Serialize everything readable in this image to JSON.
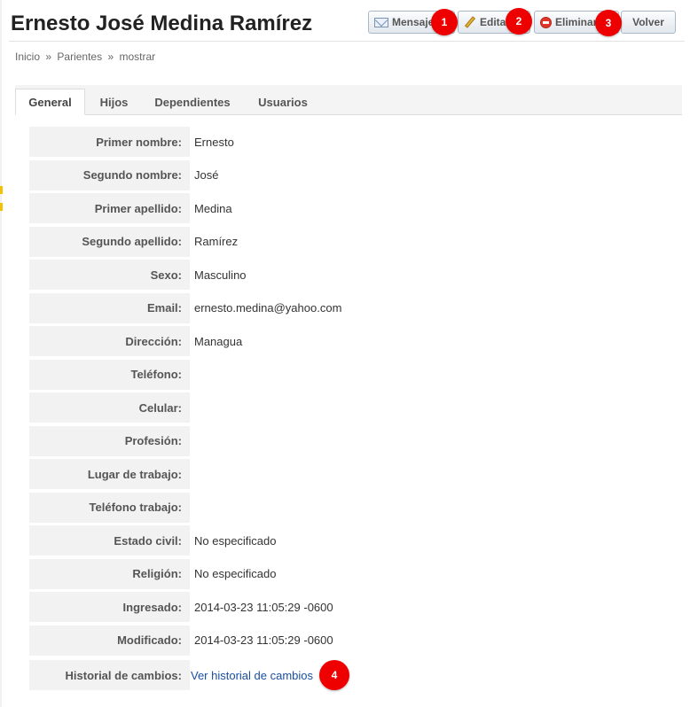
{
  "page": {
    "title": "Ernesto José Medina Ramírez"
  },
  "toolbar": {
    "mensaje_label": "Mensaje",
    "editar_label": "Editar",
    "eliminar_label": "Eliminar",
    "volver_label": "Volver"
  },
  "badges": [
    "1",
    "2",
    "3",
    "4"
  ],
  "breadcrumb": {
    "items": [
      "Inicio",
      "Parientes",
      "mostrar"
    ],
    "separator": "»"
  },
  "tabs": [
    {
      "label": "General",
      "active": true
    },
    {
      "label": "Hijos",
      "active": false
    },
    {
      "label": "Dependientes",
      "active": false
    },
    {
      "label": "Usuarios",
      "active": false
    }
  ],
  "details": [
    {
      "label": "Primer nombre:",
      "value": "Ernesto"
    },
    {
      "label": "Segundo nombre:",
      "value": "José"
    },
    {
      "label": "Primer apellido:",
      "value": "Medina"
    },
    {
      "label": "Segundo apellido:",
      "value": "Ramírez"
    },
    {
      "label": "Sexo:",
      "value": "Masculino"
    },
    {
      "label": "Email:",
      "value": "ernesto.medina@yahoo.com"
    },
    {
      "label": "Dirección:",
      "value": "Managua"
    },
    {
      "label": "Teléfono:",
      "value": ""
    },
    {
      "label": "Celular:",
      "value": ""
    },
    {
      "label": "Profesión:",
      "value": ""
    },
    {
      "label": "Lugar de trabajo:",
      "value": ""
    },
    {
      "label": "Teléfono trabajo:",
      "value": ""
    },
    {
      "label": "Estado civil:",
      "value": "No especificado"
    },
    {
      "label": "Religión:",
      "value": "No especificado"
    },
    {
      "label": "Ingresado:",
      "value": "2014-03-23 11:05:29 -0600"
    },
    {
      "label": "Modificado:",
      "value": "2014-03-23 11:05:29 -0600"
    },
    {
      "label": "Historial de cambios:",
      "value": "Ver historial de cambios"
    }
  ],
  "colors": {
    "badge": "#ee0000",
    "link": "#1a4fa0",
    "label_bg": "#f2f2f2"
  },
  "icons": [
    "envelope-icon",
    "pencil-icon",
    "no-entry-icon"
  ]
}
